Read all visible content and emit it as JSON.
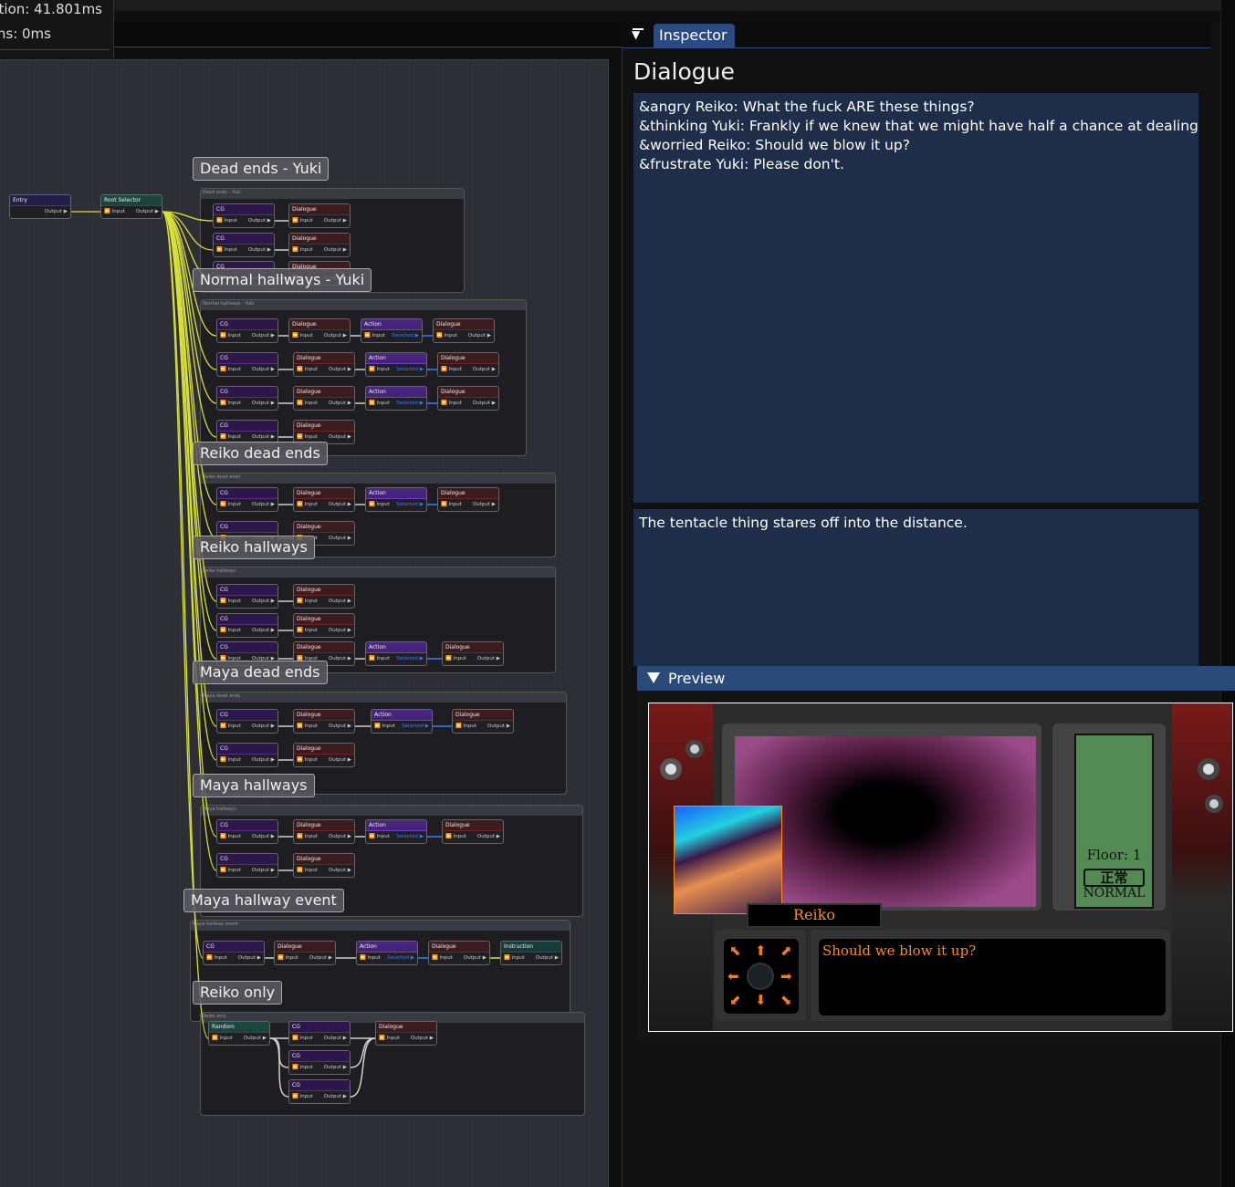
{
  "stats": {
    "line1": "tion: 41.801ms",
    "line2": "ns: 0ms"
  },
  "graph": {
    "ports": {
      "input": "Input",
      "output": "Output",
      "selected": "Selected"
    },
    "entry": {
      "title": "Entry"
    },
    "root": {
      "title": "Root Selector"
    },
    "colors": {
      "CG": "#2e1650",
      "Dialogue": "#3f1b1e",
      "Action": "#4b2585",
      "Instruction": "#153f3c",
      "Random": "#1b4a45",
      "Entry": "#221d50",
      "Root Selector": "#1a4a42",
      "wire_root": "#d8e03a",
      "wire_link": "#d0d0d0",
      "wire_selected": "#3a7cff"
    },
    "groups": [
      {
        "title": "Dead ends - Yuki",
        "rows": [
          [
            "CG",
            "Dialogue"
          ],
          [
            "CG",
            "Dialogue"
          ],
          [
            "CG",
            "Dialogue"
          ]
        ]
      },
      {
        "title": "Normal hallways - Yuki",
        "rows": [
          [
            "CG",
            "Dialogue",
            "Action",
            "Dialogue"
          ],
          [
            "CG",
            "Dialogue",
            "Action",
            "Dialogue"
          ],
          [
            "CG",
            "Dialogue",
            "Action",
            "Dialogue"
          ],
          [
            "CG",
            "Dialogue"
          ]
        ]
      },
      {
        "title": "Reiko dead ends",
        "rows": [
          [
            "CG",
            "Dialogue",
            "Action",
            "Dialogue"
          ],
          [
            "CG",
            "Dialogue"
          ]
        ]
      },
      {
        "title": "Reiko hallways",
        "rows": [
          [
            "CG",
            "Dialogue"
          ],
          [
            "CG",
            "Dialogue"
          ],
          [
            "CG",
            "Dialogue",
            "Action",
            "Dialogue"
          ]
        ]
      },
      {
        "title": "Maya dead ends",
        "rows": [
          [
            "CG",
            "Dialogue",
            "Action",
            "Dialogue"
          ],
          [
            "CG",
            "Dialogue"
          ]
        ]
      },
      {
        "title": "Maya hallways",
        "rows": [
          [
            "CG",
            "Dialogue",
            "Action",
            "Dialogue"
          ],
          [
            "CG",
            "Dialogue"
          ]
        ]
      },
      {
        "title": "Maya hallway event",
        "rows": [
          [
            "CG",
            "Dialogue",
            "Action",
            "Dialogue",
            "Instruction"
          ]
        ]
      },
      {
        "title": "Reiko only",
        "rows": [
          [
            "Random",
            "CG",
            "Dialogue"
          ],
          [
            "CG"
          ],
          [
            "CG"
          ]
        ]
      }
    ]
  },
  "inspector": {
    "tab": "Inspector",
    "title": "Dialogue",
    "dialogue_lines": [
      "&angry Reiko: What the fuck ARE these things?",
      "&thinking Yuki: Frankly if we knew that we might have half a chance at dealing",
      "&worried Reiko: Should we blow it up?",
      "&frustrate Yuki: Please don't."
    ],
    "description": "The tentacle thing stares off into the distance."
  },
  "preview": {
    "title": "Preview",
    "speaker": "Reiko",
    "line": "Should we blow it up?",
    "floor": "Floor: 1",
    "status_kanji": "正常",
    "status": "NORMAL"
  }
}
